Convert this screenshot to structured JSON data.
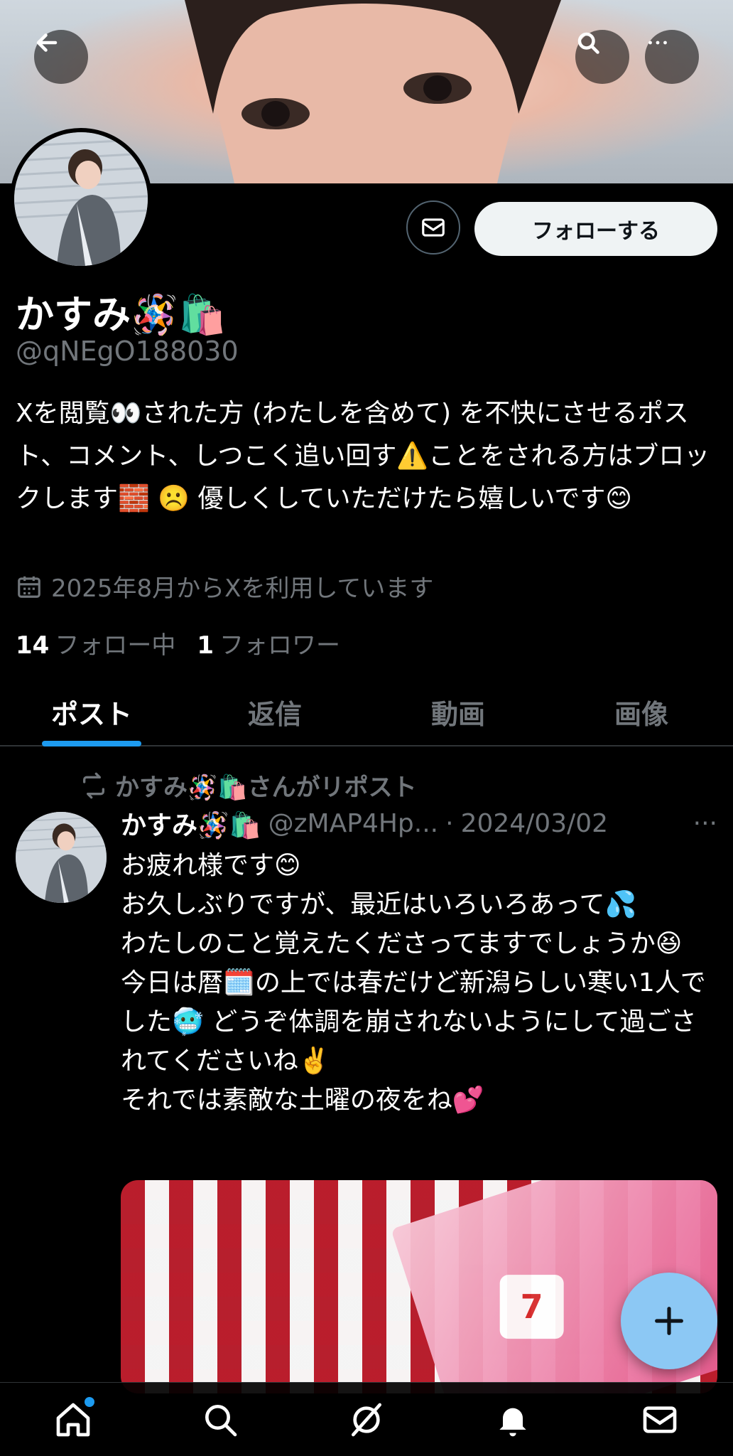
{
  "colors": {
    "accent": "#1d9bf0",
    "fab": "#8cc8f4",
    "muted": "#71767b",
    "background": "#000000"
  },
  "top_nav": {
    "back_icon": "arrow-left-icon",
    "search_icon": "search-icon",
    "more_icon": "more-horizontal-icon"
  },
  "profile": {
    "name": "かすみ🪅🛍️",
    "handle": "@qNEgO188030",
    "bio": "Xを閲覧👀された方 (わたしを含めて) を不快にさせるポスト、コメント、しつこく追い回す⚠️ことをされる方はブロックします🧱 ☹️ 優しくしていただけたら嬉しいです😊",
    "joined": "2025年8月からXを利用しています",
    "following_count": "14",
    "following_label": "フォロー中",
    "followers_count": "1",
    "followers_label": "フォロワー",
    "follow_button": "フォローする",
    "message_icon": "mail-icon",
    "calendar_icon": "calendar-icon"
  },
  "tabs": [
    {
      "label": "ポスト",
      "active": true
    },
    {
      "label": "返信",
      "active": false
    },
    {
      "label": "動画",
      "active": false
    },
    {
      "label": "画像",
      "active": false
    }
  ],
  "post": {
    "repost_text": "かすみ🪅🛍️さんがリポスト",
    "repost_icon": "repost-icon",
    "name": "かすみ🪅🛍️",
    "handle": "@zMAP4Hp...",
    "separator": "·",
    "date": "2024/03/02",
    "more": "···",
    "text": "お疲れ様です😊\nお久しぶりですが、最近はいろいろあって💦\nわたしのこと覚えたくださってますでしょうか😆\n今日は暦🗓️の上では春だけど新潟らしい寒い1人でした🥶 どうぞ体調を崩されないようにして過ごされてくださいね✌️\nそれでは素敵な土曜の夜をね💕",
    "image_logo_text": "7"
  },
  "fab": {
    "icon": "plus-icon"
  },
  "bottom_nav": [
    {
      "icon": "home-icon",
      "has_dot": true
    },
    {
      "icon": "search-icon",
      "has_dot": false
    },
    {
      "icon": "grok-icon",
      "has_dot": false
    },
    {
      "icon": "bell-icon",
      "has_dot": false
    },
    {
      "icon": "mail-icon",
      "has_dot": false
    }
  ]
}
